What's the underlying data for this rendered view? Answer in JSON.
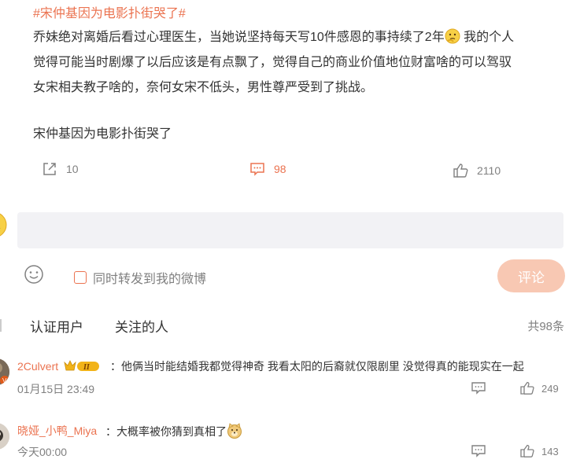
{
  "post": {
    "hashtag": "#宋仲基因为电影扑街哭了#",
    "lines": [
      "乔妹绝对离婚后看过心理医生，当她说坚持每天写10件感恩的事持续了2年",
      "我的个人",
      "觉得可能当时剧爆了以后应该是有点飘了，觉得自己的商业价值地位财富啥的可以驾驭",
      "女宋相夫教子啥的，奈何女宋不低头，男性尊严受到了挑战。"
    ],
    "tail": "宋仲基因为电影扑街哭了",
    "emoji_icon": "thinking-face-emoji"
  },
  "actions": {
    "repost_count": "10",
    "comment_count": "98",
    "like_count": "2110"
  },
  "composer": {
    "input_value": "",
    "repost_label": "同时转发到我的微博",
    "submit_label": "评论"
  },
  "filters": {
    "tab_verified": "认证用户",
    "tab_following": "关注的人",
    "total": "共98条"
  },
  "comments": [
    {
      "user": "2Culvert",
      "badge": "II",
      "text": "：他俩当时能结婚我都觉得神奇 我看太阳的后裔就仅限剧里 没觉得真的能现实在一起",
      "time": "01月15日 23:49",
      "likes": "249"
    },
    {
      "user": "晓娅_小鸭_Miya",
      "text": "：大概率被你猜到真相了",
      "emoji": "doge-emoji",
      "time": "今天00:00",
      "likes": "143"
    }
  ],
  "colors": {
    "accent": "#eb7350",
    "text": "#333333",
    "muted": "#808080",
    "input_bg": "#f2f2f5",
    "button_disabled": "#f8c8b3"
  }
}
